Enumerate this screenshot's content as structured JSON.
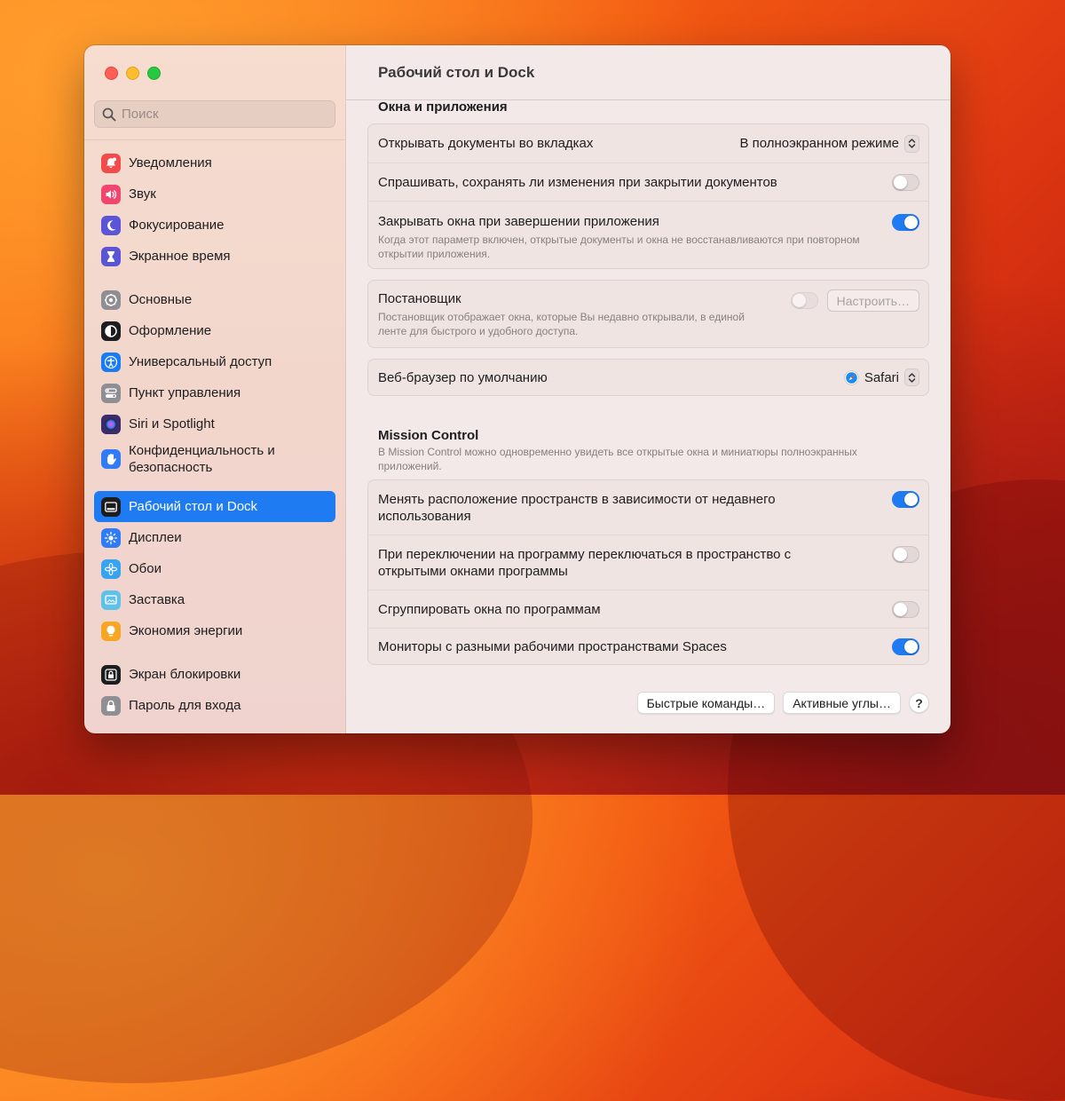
{
  "window": {
    "title": "Рабочий стол и Dock"
  },
  "search": {
    "placeholder": "Поиск"
  },
  "sidebar": {
    "groups": [
      [
        {
          "label": "Уведомления",
          "icon": "bell-icon",
          "color": "#f34a4a"
        },
        {
          "label": "Звук",
          "icon": "speaker-icon",
          "color": "#f2456f"
        },
        {
          "label": "Фокусирование",
          "icon": "moon-icon",
          "color": "#5a54d6"
        },
        {
          "label": "Экранное время",
          "icon": "hourglass-icon",
          "color": "#5a54d6"
        }
      ],
      [
        {
          "label": "Основные",
          "icon": "gear-icon",
          "color": "#8e8e93"
        },
        {
          "label": "Оформление",
          "icon": "appearance-icon",
          "color": "#1d1d1f"
        },
        {
          "label": "Универсальный доступ",
          "icon": "accessibility-icon",
          "color": "#1a7cf2"
        },
        {
          "label": "Пункт управления",
          "icon": "control-center-icon",
          "color": "#8e8e93"
        },
        {
          "label": "Siri и Spotlight",
          "icon": "siri-icon",
          "color": "#3a2b6b"
        },
        {
          "label": "Конфиденциальность и безопасность",
          "icon": "hand-icon",
          "color": "#2f7cf6",
          "tall": true
        }
      ],
      [
        {
          "label": "Рабочий стол и Dock",
          "icon": "dock-icon",
          "color": "#1d1d1f",
          "active": true
        },
        {
          "label": "Дисплеи",
          "icon": "sun-icon",
          "color": "#2f7cf6"
        },
        {
          "label": "Обои",
          "icon": "flower-icon",
          "color": "#38a3f1"
        },
        {
          "label": "Заставка",
          "icon": "screensaver-icon",
          "color": "#5ec2e8"
        },
        {
          "label": "Экономия энергии",
          "icon": "bulb-icon",
          "color": "#f6a623"
        }
      ],
      [
        {
          "label": "Экран блокировки",
          "icon": "lock-screen-icon",
          "color": "#1d1d1f"
        },
        {
          "label": "Пароль для входа",
          "icon": "lock-icon",
          "color": "#8e8e93"
        }
      ]
    ]
  },
  "windows_apps": {
    "title": "Окна и приложения",
    "open_docs_label": "Открывать документы во вкладках",
    "open_docs_value": "В полноэкранном режиме",
    "ask_save_label": "Спрашивать, сохранять ли изменения при закрытии документов",
    "ask_save_on": false,
    "close_windows_label": "Закрывать окна при завершении приложения",
    "close_windows_desc": "Когда этот параметр включен, открытые документы и окна не восстанавливаются при повторном открытии приложения.",
    "close_windows_on": true
  },
  "stage_manager": {
    "label": "Постановщик",
    "desc": "Постановщик отображает окна, которые Вы недавно открывали, в единой ленте для быстрого и удобного доступа.",
    "on": false,
    "configure_label": "Настроить…"
  },
  "browser": {
    "label": "Веб-браузер по умолчанию",
    "value": "Safari"
  },
  "mission_control": {
    "title": "Mission Control",
    "desc": "В Mission Control можно одновременно увидеть все открытые окна и миниатюры полноэкранных приложений.",
    "rearrange_label": "Менять расположение пространств в зависимости от недавнего использования",
    "rearrange_on": true,
    "switch_label": "При переключении на программу переключаться в пространство с открытыми окнами программы",
    "switch_on": false,
    "group_label": "Сгруппировать окна по программам",
    "group_on": false,
    "displays_label": "Мониторы с разными рабочими пространствами Spaces",
    "displays_on": true
  },
  "footer": {
    "shortcuts_label": "Быстрые команды…",
    "hot_corners_label": "Активные углы…",
    "help_label": "?"
  }
}
